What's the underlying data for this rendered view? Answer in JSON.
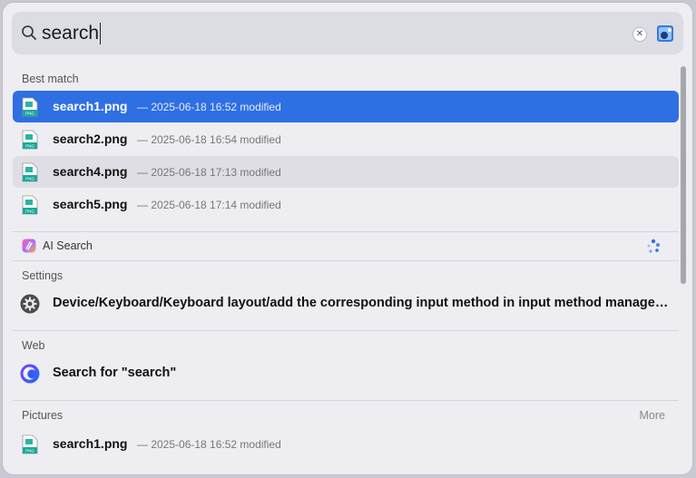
{
  "search": {
    "query": "search"
  },
  "sections": {
    "best_match": "Best match",
    "settings": "Settings",
    "web": "Web",
    "pictures": "Pictures",
    "more": "More"
  },
  "best_match_items": [
    {
      "name": "search1.png",
      "meta": "— 2025-06-18 16:52 modified"
    },
    {
      "name": "search2.png",
      "meta": "— 2025-06-18 16:54 modified"
    },
    {
      "name": "search4.png",
      "meta": "— 2025-06-18 17:13 modified"
    },
    {
      "name": "search5.png",
      "meta": "— 2025-06-18 17:14 modified"
    }
  ],
  "ai_search": {
    "label": "AI Search"
  },
  "settings_item": {
    "label": "Device/Keyboard/Keyboard layout/add the corresponding input method in input method manageme..."
  },
  "web_item": {
    "label": "Search for \"search\""
  },
  "pictures_item": {
    "name": "search1.png",
    "meta": "— 2025-06-18 16:52 modified"
  },
  "file_badge": "PNG",
  "colors": {
    "selection": "#2f6fe4",
    "panel": "#ededf2",
    "file_icon": "#1aa89a"
  }
}
